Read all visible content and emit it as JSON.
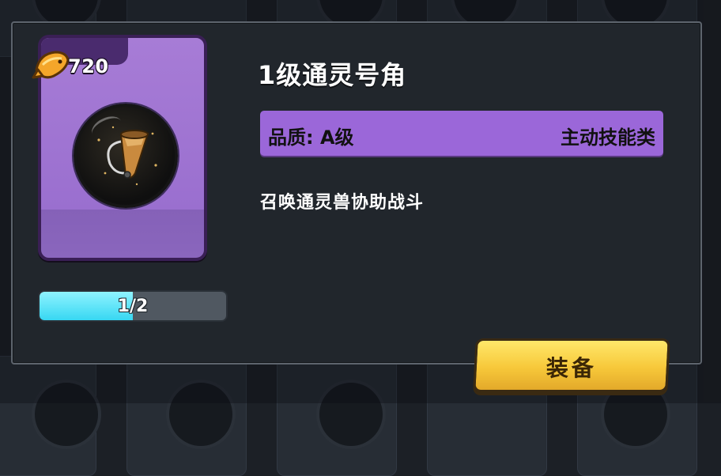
{
  "item": {
    "title": "1级通灵号角",
    "cost": "720",
    "quality": "品质: A级",
    "category": "主动技能类",
    "description": "召唤通灵兽协助战斗",
    "progress_text": "1/2",
    "progress_fraction": 0.5
  },
  "actions": {
    "equip_label": "装备"
  },
  "colors": {
    "card_purple": "#9a6fcf",
    "quality_bar": "#9b67d9",
    "progress_fill": "#37d7f2",
    "button_yellow": "#f7c83a"
  },
  "icons": {
    "cost": "fish-coin-icon",
    "item": "horn-icon"
  }
}
